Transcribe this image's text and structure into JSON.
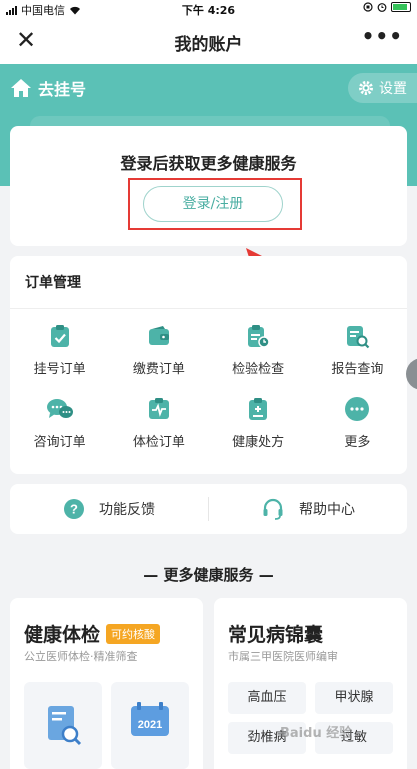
{
  "status_bar": {
    "carrier": "中国电信",
    "time": "下午 4:26"
  },
  "nav": {
    "title": "我的账户"
  },
  "banner": {
    "back_label": "去挂号",
    "settings_label": "设置"
  },
  "login": {
    "prompt": "登录后获取更多健康服务",
    "button_label": "登录/注册"
  },
  "orders": {
    "title": "订单管理",
    "items": [
      {
        "label": "挂号订单",
        "icon": "clipboard-check-icon"
      },
      {
        "label": "缴费订单",
        "icon": "wallet-icon"
      },
      {
        "label": "检验检查",
        "icon": "clipboard-clock-icon"
      },
      {
        "label": "报告查询",
        "icon": "report-search-icon"
      },
      {
        "label": "咨询订单",
        "icon": "chat-bubbles-icon"
      },
      {
        "label": "体检订单",
        "icon": "heartbeat-icon"
      },
      {
        "label": "健康处方",
        "icon": "prescription-icon"
      },
      {
        "label": "更多",
        "icon": "more-dots-icon"
      }
    ]
  },
  "help": {
    "feedback_label": "功能反馈",
    "center_label": "帮助中心"
  },
  "more_services": {
    "title": "— 更多健康服务 —"
  },
  "health_exam": {
    "title": "健康体检",
    "tag": "可约核酸",
    "subtitle": "公立医师体检·精准筛查",
    "tile_year": "2021"
  },
  "diseases": {
    "title": "常见病锦囊",
    "subtitle": "市属三甲医院医师编审",
    "chips": [
      "高血压",
      "甲状腺",
      "劲椎病",
      "过敏"
    ]
  },
  "watermark": "Baidu 经验",
  "colors": {
    "accent": "#5bc1b6",
    "highlight": "#e53a35",
    "tag": "#f5a623"
  }
}
